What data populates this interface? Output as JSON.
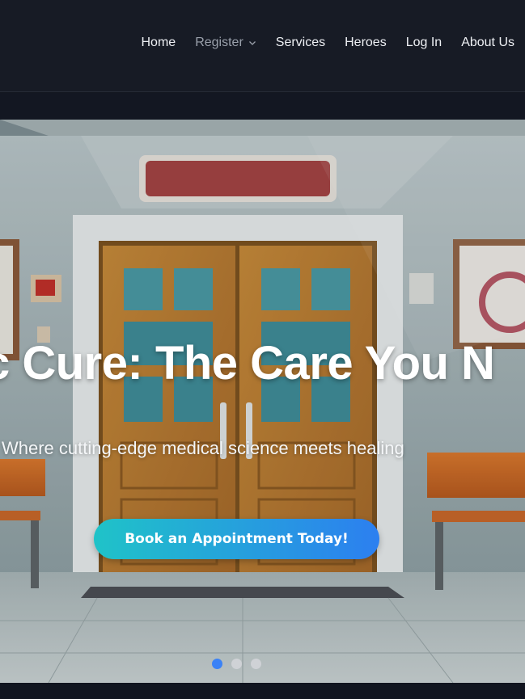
{
  "nav": {
    "items": [
      {
        "label": "Home"
      },
      {
        "label": "Register"
      },
      {
        "label": "Services"
      },
      {
        "label": "Heroes"
      },
      {
        "label": "Log In"
      },
      {
        "label": "About Us"
      }
    ],
    "dropdown_icon": "chevron-down-icon"
  },
  "hero": {
    "title": "c Cure: The Care You N",
    "subtitle": "Where cutting-edge medical science meets healing",
    "cta_label": "Book an Appointment Today!",
    "slides_total": 3,
    "active_slide": 1
  },
  "colors": {
    "nav_bg": "#171b25",
    "accent_start": "#1fc3c8",
    "accent_end": "#2c7ff0",
    "active_dot": "#3b82f6"
  }
}
